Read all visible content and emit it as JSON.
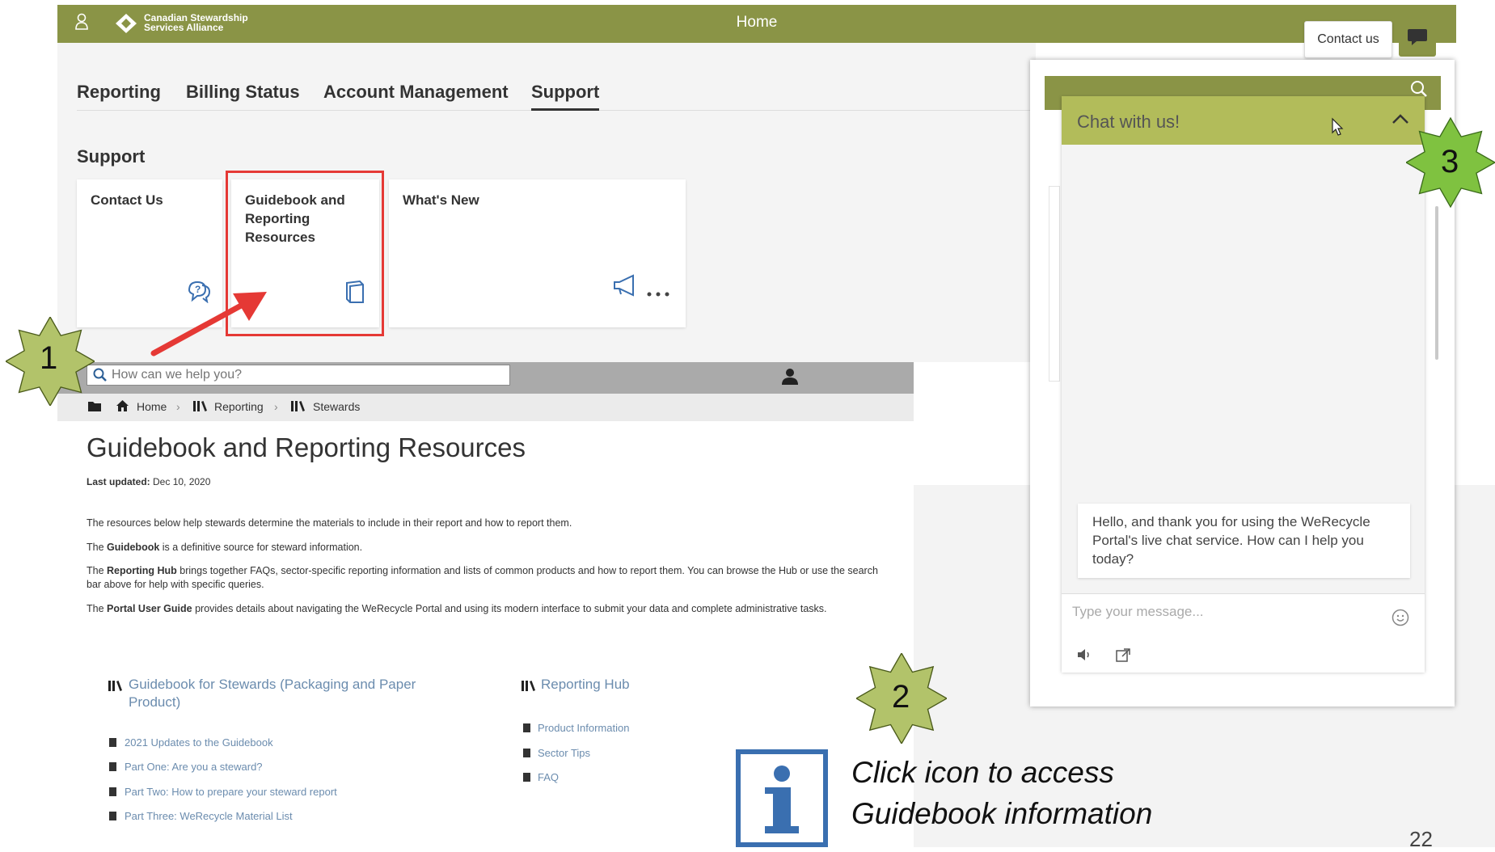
{
  "header": {
    "title": "Home",
    "logo_line1": "Canadian Stewardship",
    "logo_line2": "Services Alliance",
    "contact_label": "Contact us"
  },
  "nav": {
    "tabs": [
      "Reporting",
      "Billing Status",
      "Account Management",
      "Support"
    ],
    "active_tab": "Support"
  },
  "support": {
    "heading": "Support",
    "cards": [
      {
        "title": "Contact Us",
        "icon": "chat-question-icon"
      },
      {
        "title_lines": [
          "Guidebook and",
          "Reporting",
          "Resources"
        ],
        "icon": "book-icon"
      },
      {
        "title": "What's New",
        "icon": "megaphone-icon"
      }
    ]
  },
  "search": {
    "placeholder": "How can we help you?"
  },
  "breadcrumb": [
    "Home",
    "Reporting",
    "Stewards"
  ],
  "page": {
    "title": "Guidebook and Reporting Resources",
    "last_updated_label": "Last updated:",
    "last_updated_value": "Dec 10, 2020",
    "intro": "The resources below help stewards determine the materials to include in their report and how to report them.",
    "p2_pre": "The ",
    "p2_bold": "Guidebook",
    "p2_post": " is a definitive source for steward information.",
    "p3_pre": "The ",
    "p3_bold": "Reporting Hub",
    "p3_post": " brings together FAQs, sector-specific reporting information and lists of common products and how to report them. You can browse the Hub or use the search bar above for help with specific queries.",
    "p4_pre": "The ",
    "p4_bold": "Portal User Guide",
    "p4_post": " provides details about navigating the WeRecycle Portal and using its modern interface to submit your data and complete administrative tasks."
  },
  "guidebook_section": {
    "title_line1": "Guidebook for Stewards (Packaging and Paper",
    "title_line2": "Product)",
    "links": [
      "2021 Updates to the Guidebook",
      "Part One: Are you a steward?",
      "Part Two: How to prepare your steward report",
      "Part Three: WeRecycle Material List"
    ]
  },
  "hub_section": {
    "title": "Reporting Hub",
    "links": [
      "Product Information",
      "Sector Tips",
      "FAQ"
    ]
  },
  "chat": {
    "title": "Chat with us!",
    "greeting": "Hello, and thank you for using the WeRecycle Portal's live chat service. How can I help you today?",
    "input_placeholder": "Type your message..."
  },
  "annotations": {
    "markers": [
      "1",
      "2",
      "3"
    ],
    "instruction_line1": "Click icon to access",
    "instruction_line2": "Guidebook information",
    "page_number": "22"
  },
  "colors": {
    "brand_olive": "#8a9446",
    "chat_header": "#b2bc5a",
    "star_green": "#b2c36a",
    "highlight_red": "#e53935",
    "link_blue": "#6b8cae",
    "info_blue": "#3a6fb0"
  }
}
